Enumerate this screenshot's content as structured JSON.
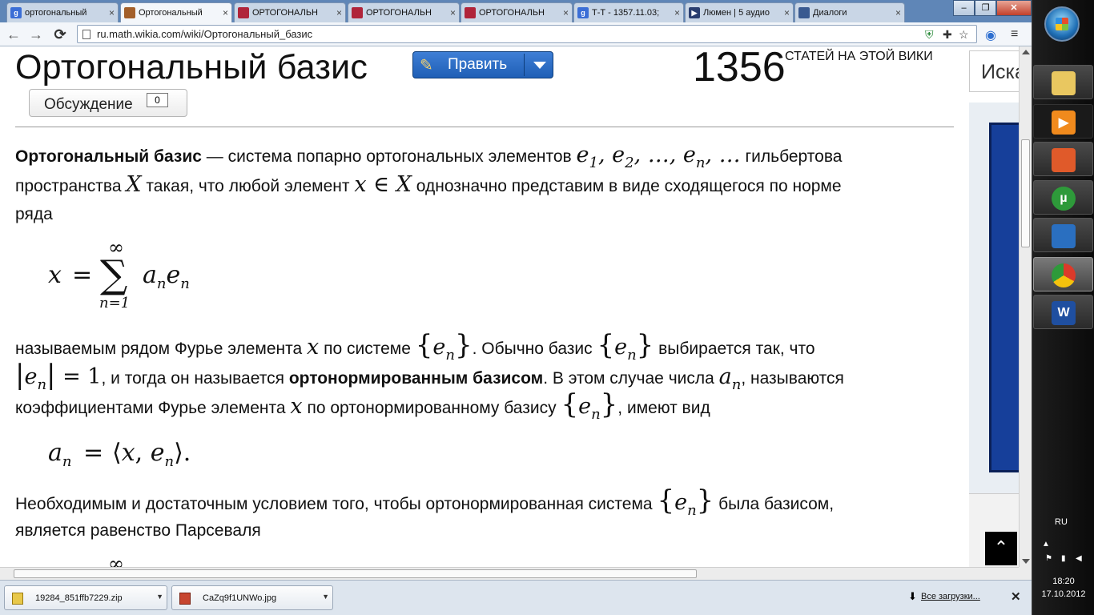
{
  "tabs": [
    {
      "label": "ортогональный",
      "fav_color": "#3b6ed6",
      "fav_text": "g",
      "active": false
    },
    {
      "label": "Ортогональный",
      "fav_color": "#a35f2a",
      "fav_text": "",
      "active": true
    },
    {
      "label": "ОРТОГОНАЛЬН",
      "fav_color": "#b0243a",
      "fav_text": "",
      "active": false
    },
    {
      "label": "ОРТОГОНАЛЬН",
      "fav_color": "#b0243a",
      "fav_text": "",
      "active": false
    },
    {
      "label": "ОРТОГОНАЛЬН",
      "fav_color": "#b0243a",
      "fav_text": "",
      "active": false
    },
    {
      "label": "Т-Т - 1357.11.03;",
      "fav_color": "#3b6ed6",
      "fav_text": "g",
      "active": false
    },
    {
      "label": "Люмен | 5 аудио",
      "fav_color": "#2a3e70",
      "fav_text": "▶",
      "active": false
    },
    {
      "label": "Диалоги",
      "fav_color": "#3a5a90",
      "fav_text": "",
      "active": false
    }
  ],
  "toolbar": {
    "url": "ru.math.wikia.com/wiki/Ортогональный_базис"
  },
  "page": {
    "title": "Ортогональный базис",
    "edit_label": "Править",
    "article_count": "1356",
    "article_count_label": "СТАТЕЙ НА ЭТОЙ ВИКИ",
    "talk_label": "Обсуждение",
    "talk_count": "0",
    "search_placeholder": "Иска"
  },
  "article": {
    "p1_term": "Ортогональный базис",
    "p1_a": " — система попарно ортогональных элементов ",
    "p1_b": " гильбертова",
    "p1_c": "пространства ",
    "p1_d": " такая, что любой элемент ",
    "p1_e": " однозначно представим в виде сходящегося по норме",
    "p1_f": "ряда",
    "p2_a": "называемым рядом Фурье элемента ",
    "p2_b": " по системе ",
    "p2_c": ". Обычно базис ",
    "p2_d": " выбирается так, что",
    "p2_e": ", и тогда он называется ",
    "p2_f": "ортонормированным базисом",
    "p2_g": ". В этом случае числа ",
    "p2_h": ", называются",
    "p2_i": "коэффициентами Фурье элемента ",
    "p2_j": " по ортонормированному базису ",
    "p2_k": ", имеют вид",
    "p3_a": "Необходимым и достаточным условием того, чтобы ортонормированная система ",
    "p3_b": " была базисом,",
    "p3_c": "является равенство Парсеваля"
  },
  "downloads": {
    "item1": "19284_851ffb7229.zip",
    "item2": "CaZq9f1UNWo.jpg",
    "all_label": "Все загрузки..."
  },
  "taskbar": {
    "lang": "RU",
    "time": "18:20",
    "date": "17.10.2012"
  }
}
